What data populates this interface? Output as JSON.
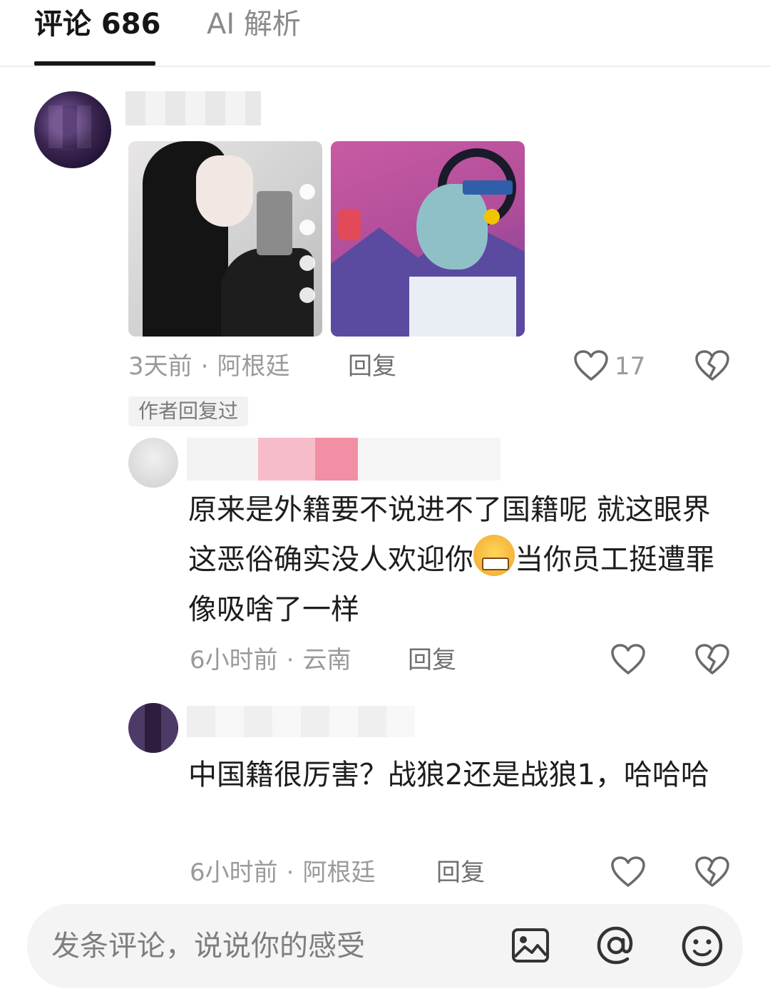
{
  "tabs": {
    "comments_label": "评论 686",
    "ai_label": "AI 解析"
  },
  "comment_main": {
    "time": "3天前",
    "location": "阿根廷",
    "reply_label": "回复",
    "like_count": "17",
    "author_badge": "作者回复过"
  },
  "reply_1": {
    "text_before_emoji": "原来是外籍要不说进不了国籍呢 就这眼界这恶俗确实没人欢迎你",
    "text_after_emoji": "当你员工挺遭罪 像吸啥了一样",
    "time": "6小时前",
    "location": "云南",
    "reply_label": "回复"
  },
  "reply_2": {
    "text": "中国籍很厉害？战狼2还是战狼1，哈哈哈",
    "time": "6小时前",
    "location": "阿根廷",
    "reply_label": "回复"
  },
  "meta_separator": "·",
  "composer": {
    "placeholder": "发条评论，说说你的感受"
  },
  "icons": [
    "heart-icon",
    "broken-heart-icon",
    "image-icon",
    "at-icon",
    "emoji-icon"
  ],
  "colors": {
    "accent": "#161616",
    "muted": "#9a9a9a"
  }
}
